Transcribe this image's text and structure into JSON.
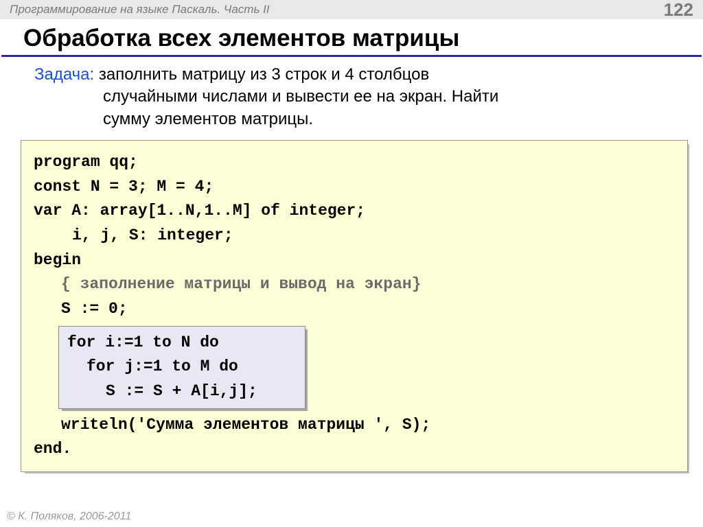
{
  "header": {
    "breadcrumb": "Программирование на языке Паскаль. Часть II",
    "page_number": "122"
  },
  "title": "Обработка всех элементов матрицы",
  "task": {
    "label": "Задача:",
    "line1": " заполнить матрицу из 3 строк и 4 столбцов",
    "line2": "случайными числами и вывести ее на экран. Найти",
    "line3": "сумму элементов матрицы."
  },
  "code": {
    "l1": "program qq;",
    "l2": "const N = 3; M = 4;",
    "l3": "var A: array[1..N,1..M] of integer;",
    "l4": "i, j, S: integer;",
    "l5": "begin",
    "l6": "{ заполнение матрицы и вывод на экран}",
    "l7": "S := 0;",
    "inner": {
      "l1": "for i:=1 to N do",
      "l2": "for j:=1 to M do",
      "l3": "S := S + A[i,j];"
    },
    "l8": "writeln('Сумма элементов матрицы ', S);",
    "l9": "end."
  },
  "footer": "© К. Поляков, 2006-2011"
}
